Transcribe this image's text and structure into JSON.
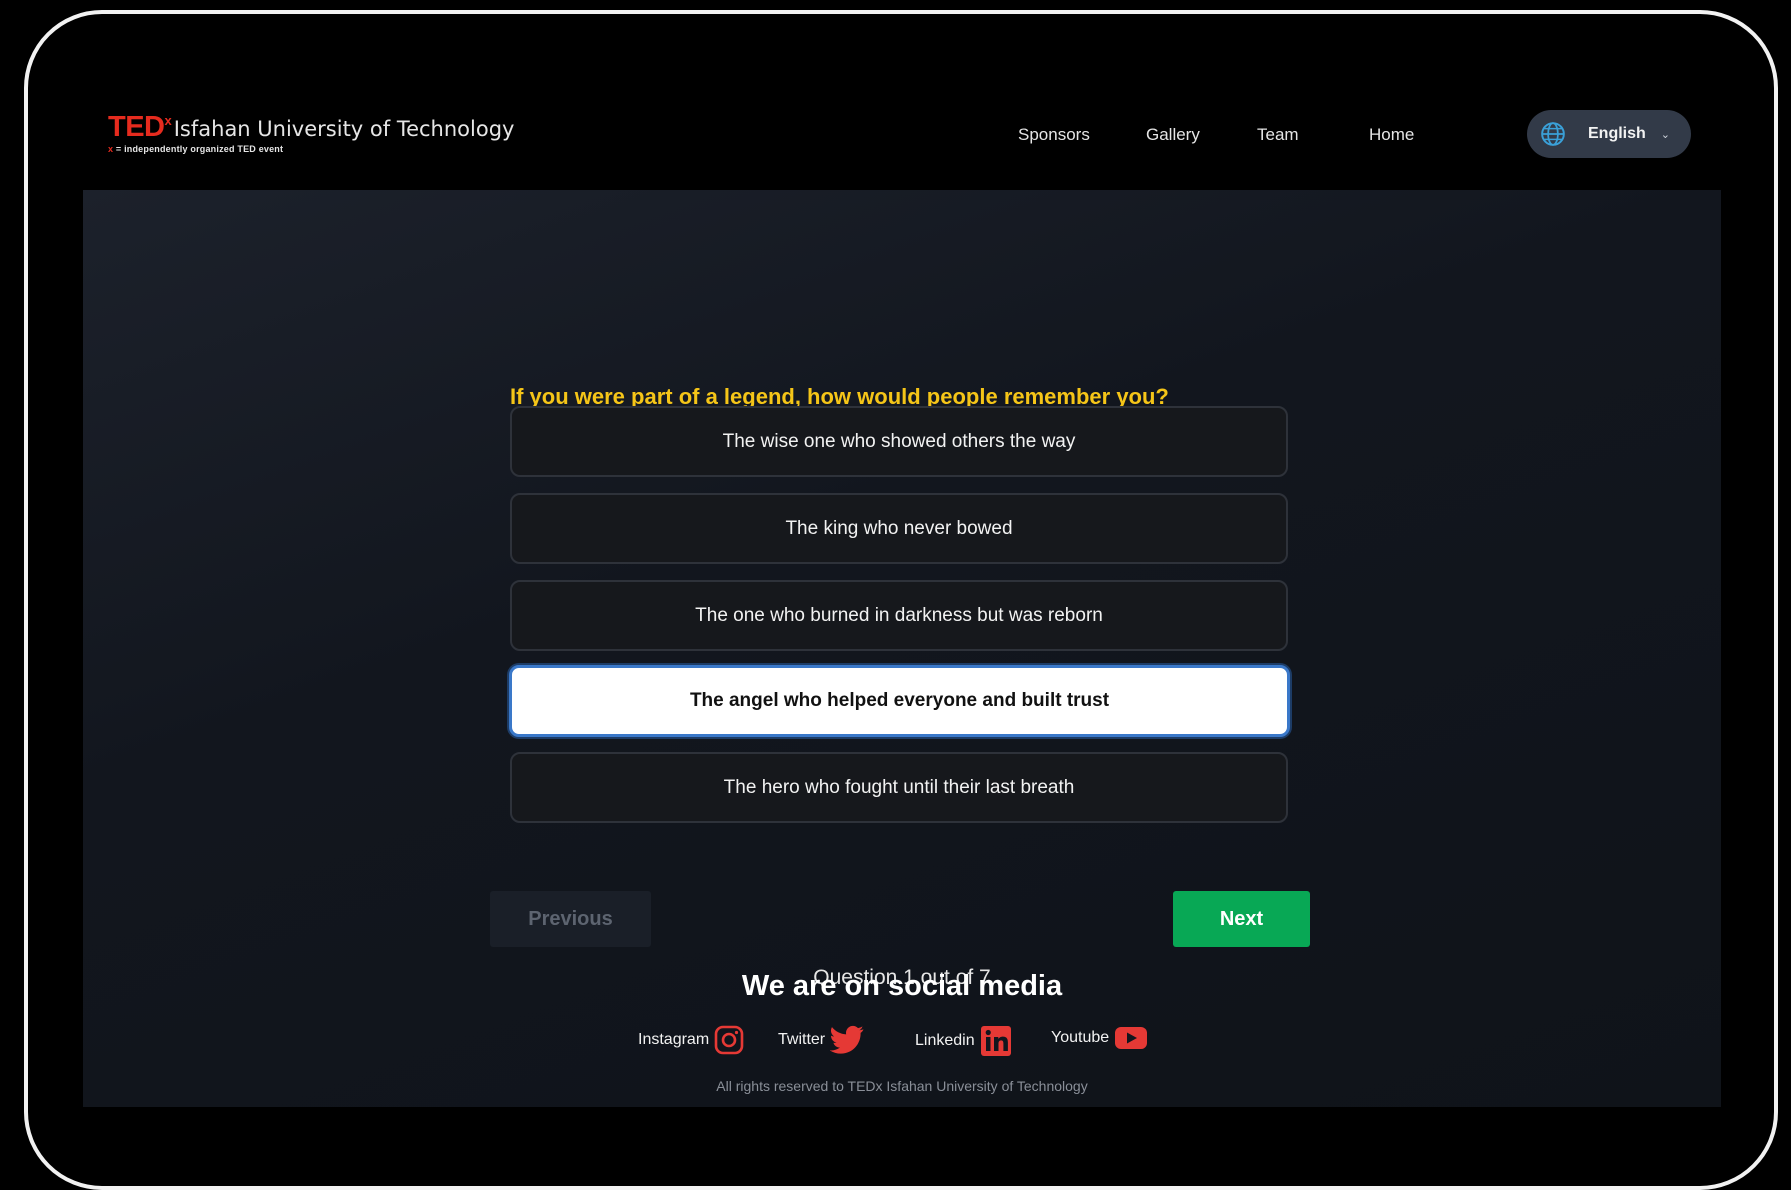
{
  "header": {
    "logo": {
      "brand": "TED",
      "superscript": "x",
      "name": "Isfahan University of Technology",
      "tagline_x": "x",
      "tagline": "= independently organized TED event"
    },
    "nav": [
      "Sponsors",
      "Gallery",
      "Team",
      "Home"
    ],
    "language": {
      "selected": "English",
      "icon": "globe-icon"
    }
  },
  "quiz": {
    "question": "If you were part of a legend, how would people remember you?",
    "options": [
      "The wise one who showed others the way",
      "The king who never bowed",
      "The one who burned in darkness but was reborn",
      "The angel who helped everyone and built trust",
      "The hero who fought until their last breath"
    ],
    "selected_index": 3,
    "previous_label": "Previous",
    "next_label": "Next",
    "progress_text": "Question 1 out of 7"
  },
  "footer": {
    "social_title": "We are on social media",
    "social": [
      {
        "label": "Instagram",
        "icon": "instagram-icon"
      },
      {
        "label": "Twitter",
        "icon": "twitter-icon"
      },
      {
        "label": "Linkedin",
        "icon": "linkedin-icon"
      },
      {
        "label": "Youtube",
        "icon": "youtube-icon"
      }
    ],
    "copyright": "All rights reserved to TEDx Isfahan University of Technology"
  },
  "colors": {
    "accent_question": "#f5c518",
    "next_button": "#08a855",
    "ted_red": "#e62b1e",
    "social_icon": "#e53935"
  }
}
